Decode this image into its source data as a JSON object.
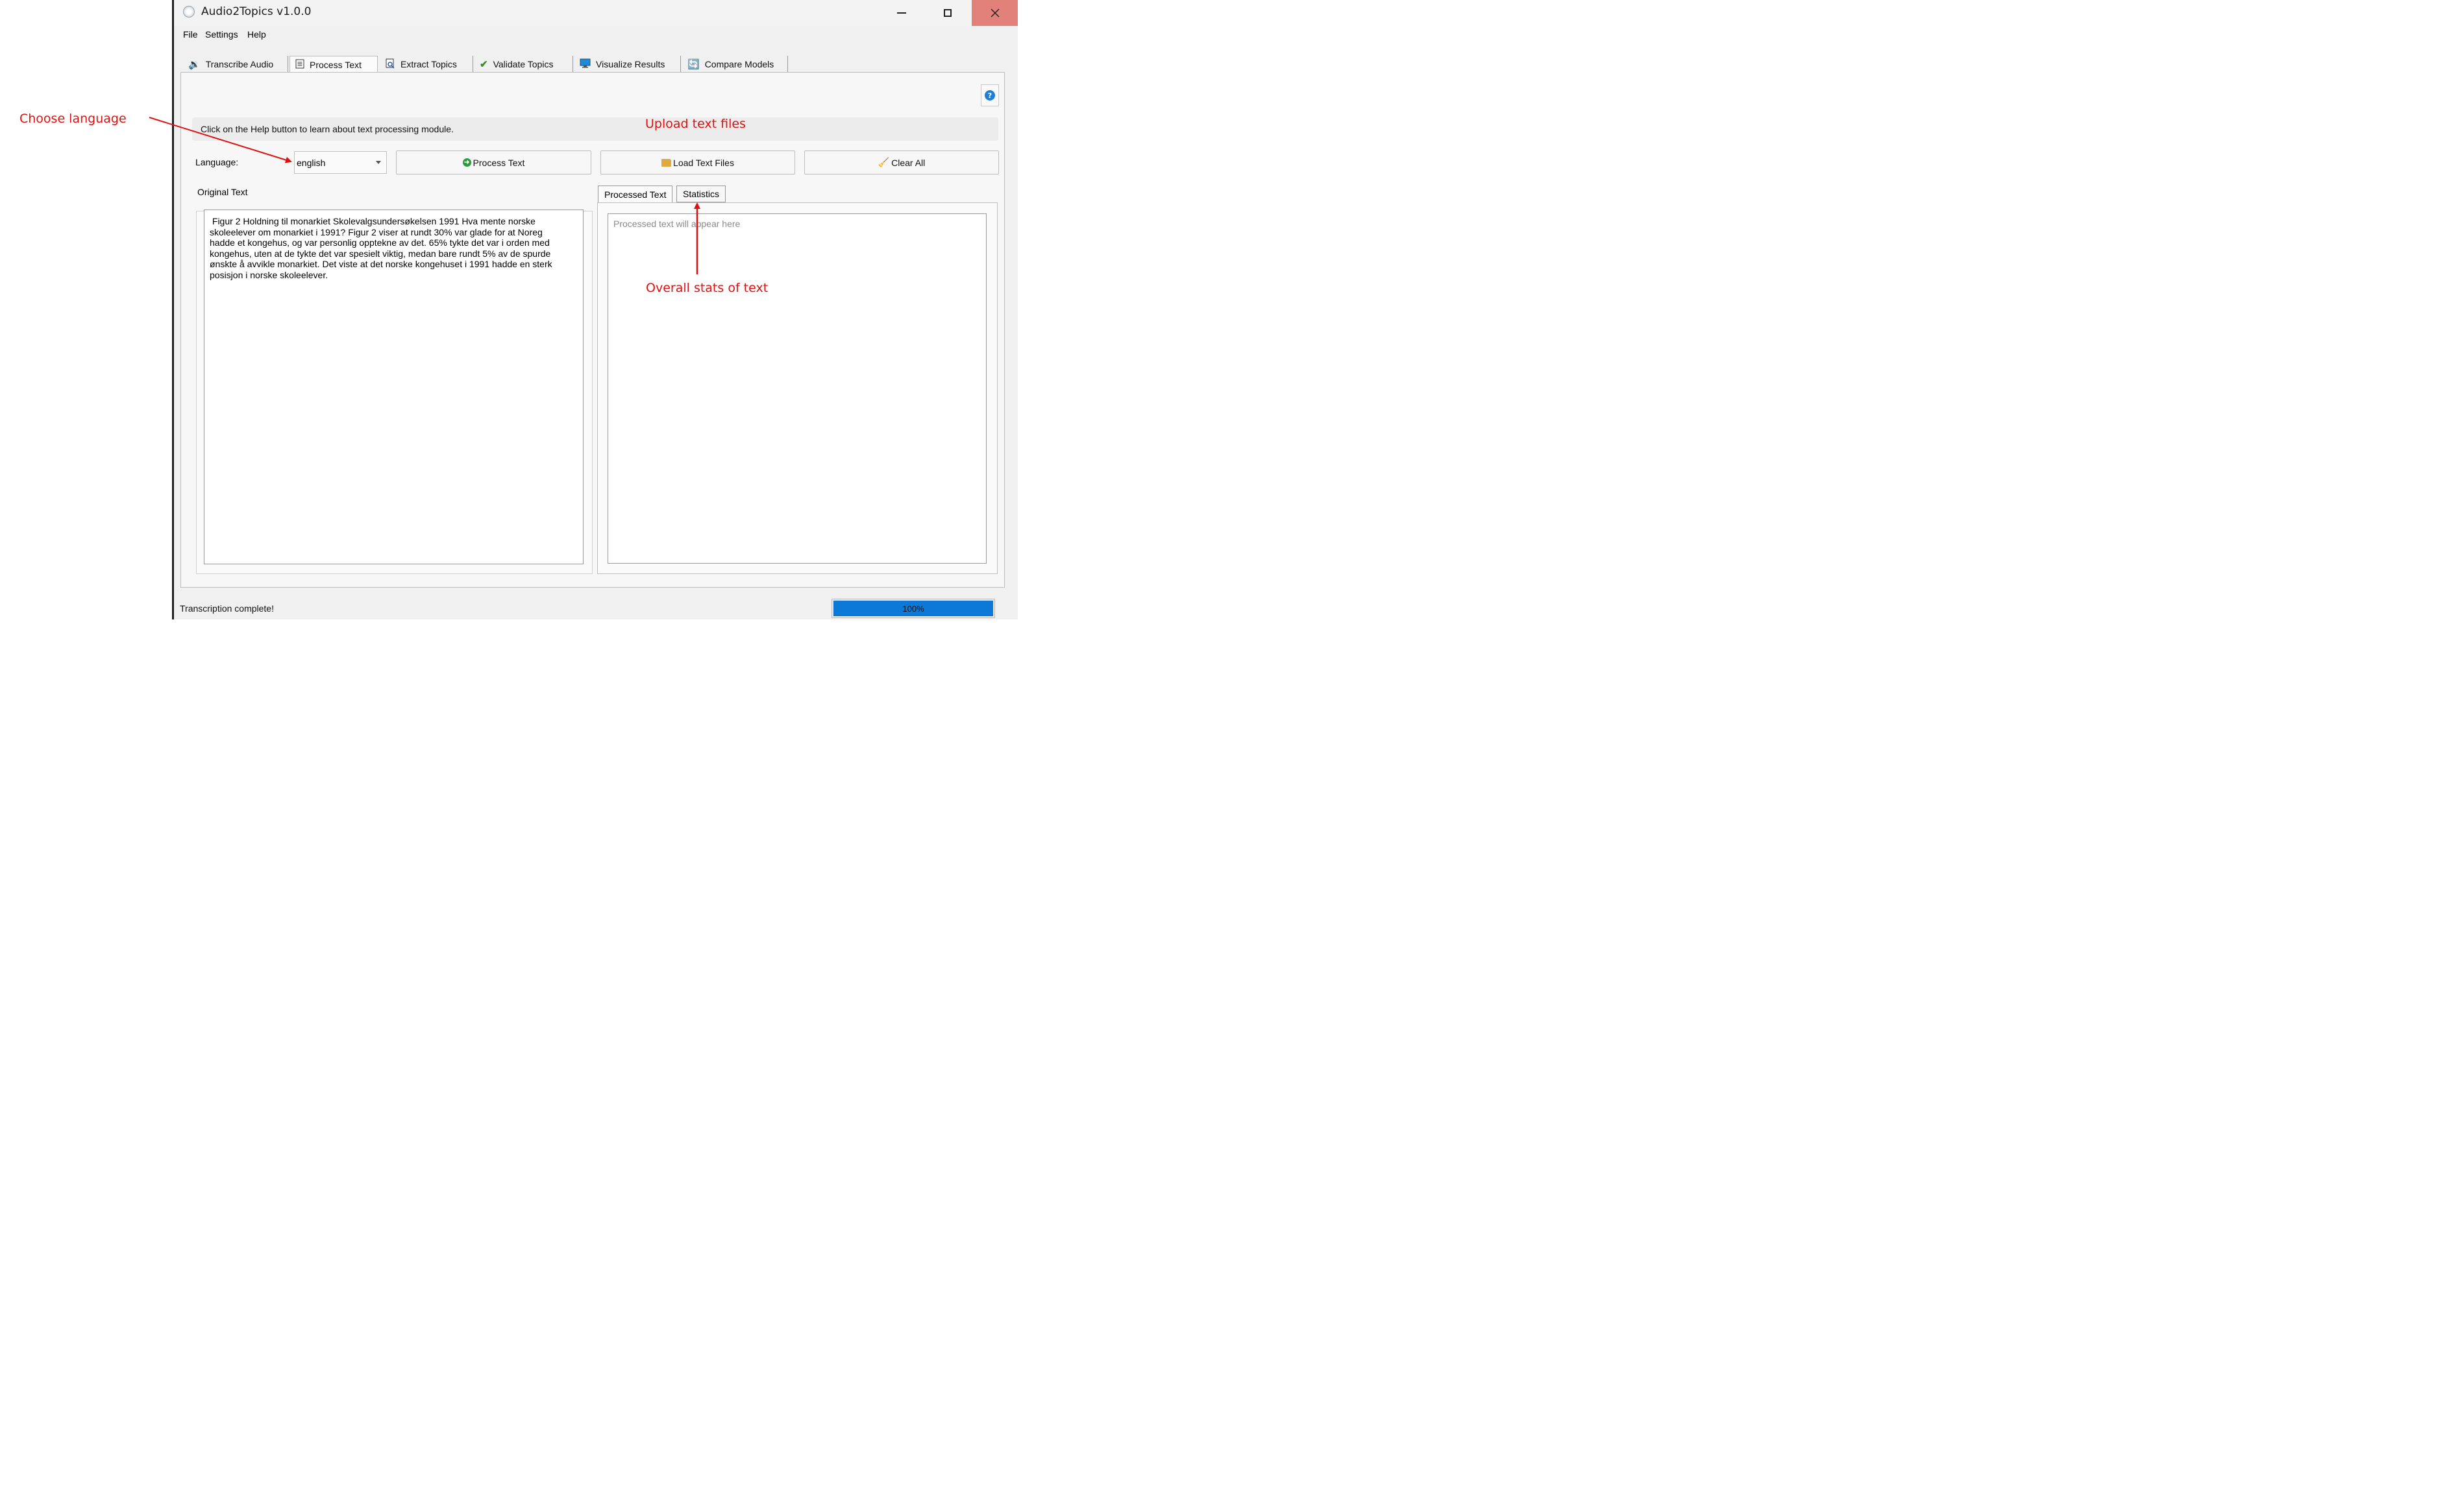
{
  "window": {
    "title": "Audio2Topics v1.0.0"
  },
  "menu": {
    "items": [
      {
        "label": "File"
      },
      {
        "label": "Settings"
      },
      {
        "label": "Help"
      }
    ]
  },
  "tabs": [
    {
      "label": "Transcribe Audio",
      "icon": "speaker-icon"
    },
    {
      "label": "Process Text",
      "icon": "document-icon"
    },
    {
      "label": "Extract Topics",
      "icon": "search-document-icon"
    },
    {
      "label": "Validate Topics",
      "icon": "checkmark-icon"
    },
    {
      "label": "Visualize Results",
      "icon": "monitor-icon"
    },
    {
      "label": "Compare Models",
      "icon": "refresh-icon"
    }
  ],
  "active_tab": "Process Text",
  "info": {
    "text": "Click on the Help button to learn about text processing module."
  },
  "controls": {
    "language_label": "Language:",
    "language_value": "english",
    "process_label": "Process Text",
    "load_label": "Load Text Files",
    "clear_label": "Clear All"
  },
  "original": {
    "label": "Original Text",
    "text": " Figur 2 Holdning til monarkiet Skolevalgsundersøkelsen 1991 Hva mente norske\nskoleelever om monarkiet i 1991? Figur 2 viser at rundt 30% var glade for at Noreg\nhadde et kongehus, og var personlig opptekne av det. 65% tykte det var i orden med\nkongehus, uten at de tykte det var spesielt viktig, medan bare rundt 5% av de spurde\nønskte å avvikle monarkiet. Det viste at det norske kongehuset i 1991 hadde en sterk\nposisjon i norske skoleelever."
  },
  "output": {
    "tabs": [
      "Processed Text",
      "Statistics"
    ],
    "placeholder": "Processed text will appear here"
  },
  "status": {
    "text": "Transcription complete!",
    "progress_label": "100%",
    "progress_fraction": 1.0
  },
  "annotations": {
    "choose_language": "Choose language",
    "upload_text_files": "Upload text files",
    "overall_stats": "Overall stats of text"
  },
  "colors": {
    "annotation": "#e01010",
    "progress": "#0c78d8",
    "close_button": "#e2807a"
  }
}
